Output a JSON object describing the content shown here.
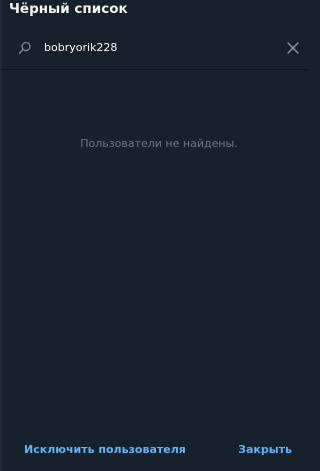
{
  "dialog": {
    "title": "Чёрный список",
    "empty_message": "Пользователи не найдены."
  },
  "search": {
    "value": "bobryorik228",
    "icon": "search-icon",
    "clear_icon": "close-icon"
  },
  "footer": {
    "exclude_label": "Исключить пользователя",
    "close_label": "Закрыть"
  },
  "colors": {
    "background": "#17212b",
    "accent": "#5eb5f7",
    "muted_text": "#6d7883",
    "text": "#f5f5f5"
  }
}
